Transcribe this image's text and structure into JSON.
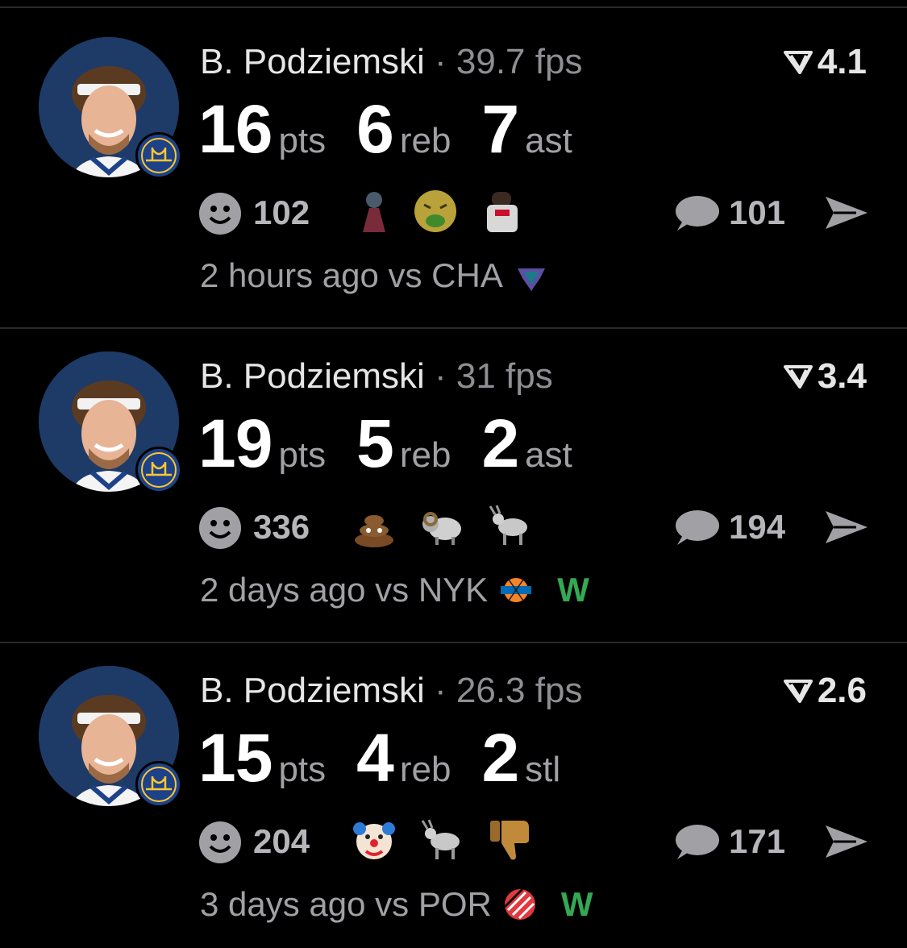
{
  "cards": [
    {
      "player_name": "B. Podziemski",
      "separator": "·",
      "fps": "39.7 fps",
      "rating": "4.1",
      "stats": [
        {
          "value": "16",
          "unit": "pts"
        },
        {
          "value": "6",
          "unit": "reb"
        },
        {
          "value": "7",
          "unit": "ast"
        }
      ],
      "reaction_count": "102",
      "reactions": [
        "volcano-emoji",
        "nauseated-face-emoji",
        "player-photo-emoji"
      ],
      "comment_count": "101",
      "time_ago": "2 hours ago vs CHA",
      "opponent_logo": "hornets-logo-icon",
      "result": ""
    },
    {
      "player_name": "B. Podziemski",
      "separator": "·",
      "fps": "31 fps",
      "rating": "3.4",
      "stats": [
        {
          "value": "19",
          "unit": "pts"
        },
        {
          "value": "5",
          "unit": "reb"
        },
        {
          "value": "2",
          "unit": "ast"
        }
      ],
      "reaction_count": "336",
      "reactions": [
        "poop-emoji",
        "ram-emoji",
        "goat-emoji"
      ],
      "comment_count": "194",
      "time_ago": "2 days ago vs NYK",
      "opponent_logo": "knicks-logo-icon",
      "result": "W"
    },
    {
      "player_name": "B. Podziemski",
      "separator": "·",
      "fps": "26.3 fps",
      "rating": "2.6",
      "stats": [
        {
          "value": "15",
          "unit": "pts"
        },
        {
          "value": "4",
          "unit": "reb"
        },
        {
          "value": "2",
          "unit": "stl"
        }
      ],
      "reaction_count": "204",
      "reactions": [
        "clown-face-emoji",
        "goat-emoji",
        "thumbs-down-emoji"
      ],
      "comment_count": "171",
      "time_ago": "3 days ago vs POR",
      "opponent_logo": "blazers-logo-icon",
      "result": "W"
    }
  ],
  "colors": {
    "background": "#000000",
    "divider": "#2a2a2c",
    "muted_text": "#8e8e93",
    "win": "#34a853",
    "team_badge": "#1d428a",
    "team_badge_accent": "#ffc72c"
  }
}
